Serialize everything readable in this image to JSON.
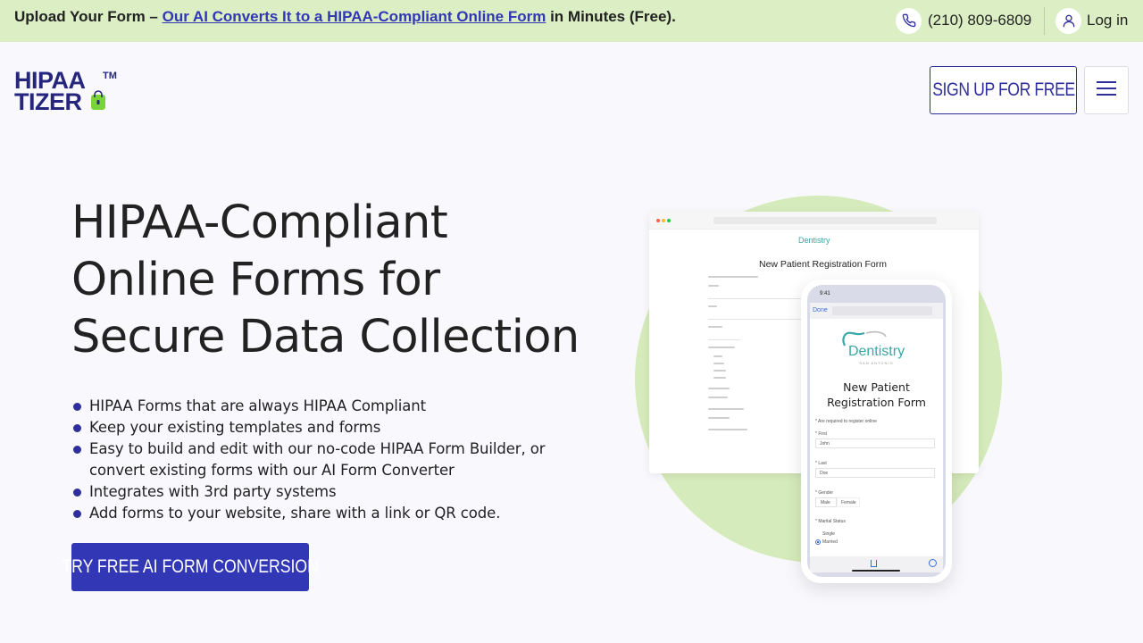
{
  "topbar": {
    "message_prefix": "Upload Your Form – ",
    "message_link": "Our AI Converts It to a HIPAA-Compliant Online Form",
    "message_suffix": " in Minutes (Free).",
    "phone": "(210) 809-6809",
    "login": "Log in"
  },
  "header": {
    "logo_line1": "HIPAA",
    "logo_line2": "TIZER",
    "logo_tm": "TM",
    "signup_label": "SIGN UP FOR FREE",
    "menu_icon": "hamburger-icon"
  },
  "hero": {
    "title_line1": "HIPAA-Compliant",
    "title_line2": "Online Forms for",
    "title_line3": "Secure Data Collection",
    "bullets": [
      "HIPAA Forms that are always HIPAA Compliant",
      "Keep your existing templates and forms",
      "Easy to build and edit with our no-code HIPAA Form Builder, or convert existing forms with our AI Form Converter",
      "Integrates with 3rd party systems",
      "Add forms to your website, share with a link or QR code."
    ],
    "cta_label": "TRY FREE AI FORM CONVERSION"
  },
  "illustration": {
    "browser_logo": "Dentistry",
    "browser_form_title": "New Patient Registration Form",
    "phone_time": "9:41",
    "phone_done": "Done",
    "phone_logo_name": "Dentistry",
    "phone_logo_sub": "SAN ANTONIO",
    "phone_form_title_line1": "New Patient",
    "phone_form_title_line2": "Registration Form",
    "phone_required_note": "* Are required to register online",
    "phone_first_label": "* First",
    "phone_first_value": "John",
    "phone_last_label": "* Last",
    "phone_last_value": "Doe",
    "phone_gender_label": "* Gender",
    "phone_gender_male": "Male",
    "phone_gender_female": "Female",
    "phone_marital_label": "* Marital Status",
    "phone_marital_single": "Single",
    "phone_marital_married": "Married"
  },
  "colors": {
    "topbar_bg": "#dbeec4",
    "brand_navy": "#2f2f9c",
    "cta_bg": "#3137b5",
    "accent_green": "#d6ebbb",
    "dentistry_teal": "#3aa7a4"
  }
}
